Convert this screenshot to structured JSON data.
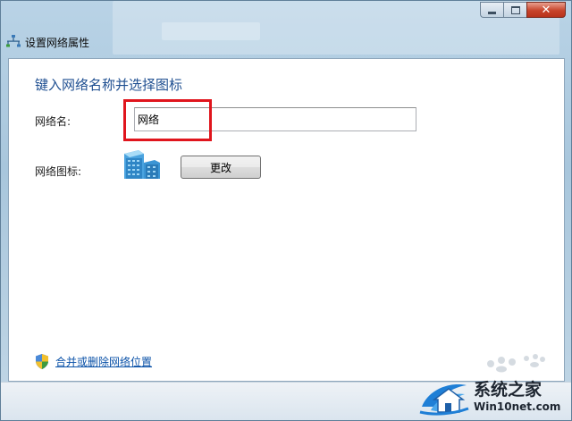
{
  "window": {
    "title": "设置网络属性",
    "icon": "network-icon",
    "caption_buttons": {
      "minimize": "minimize-icon",
      "maximize": "maximize-icon",
      "close": "close-icon"
    }
  },
  "form": {
    "heading": "键入网络名称并选择图标",
    "network_name_label": "网络名:",
    "network_name_value": "网络",
    "network_icon_label": "网络图标:",
    "network_icon": "office-building-icon",
    "change_button": "更改"
  },
  "footer_link": {
    "icon": "uac-shield-icon",
    "label": "合并或删除网络位置"
  },
  "watermark": {
    "title": "系统之家",
    "subtitle": "Win10net.com"
  },
  "colors": {
    "heading": "#1f4f91",
    "link": "#0b52a8",
    "highlight": "#e0151d",
    "close_button": "#c7432a"
  }
}
